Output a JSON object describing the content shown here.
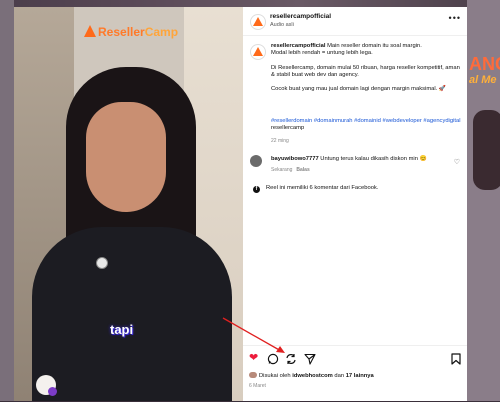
{
  "video": {
    "brand_a": "Reseller",
    "brand_b": "Camp",
    "caption": "tapi"
  },
  "background": {
    "right_text_1": "ANG",
    "right_text_2": "al Me"
  },
  "header": {
    "username": "resellercampofficial",
    "audio": "Audio asli"
  },
  "post": {
    "username": "resellercampofficial",
    "text": " Main reseller domain itu soal margin.\nModal lebih rendah = untung lebih lega.\n\nDi Resellercamp, domain mulai 50 ribuan, harga reseller kompetitif, aman & stabil buat web dev dan agency.\n\nCocok buat yang mau jual domain lagi dengan margin maksimal. 🚀",
    "hashtags": "#resellerdomain #domainmurah #domainid #webdeveloper #agencydigital",
    "mention": " resellercamp",
    "time": "22 ming"
  },
  "comment": {
    "username": "bayuwibowo7777",
    "text": " Untung terus kalau dikasih diskon min 😊",
    "time": "Sekarang",
    "reply": "Balas"
  },
  "facebook_note": "Reel ini memiliki 6 komentar dari Facebook.",
  "actions": {
    "liked_prefix": "Disukai oleh ",
    "liked_by": "idwebhostcom",
    "liked_mid": " dan ",
    "liked_others": "17 lainnya",
    "date": "6 Maret"
  },
  "icons": {
    "like": "heart-icon",
    "comment": "comment-icon",
    "repost": "repost-icon",
    "share": "share-icon",
    "save": "bookmark-icon",
    "more": "more-icon"
  },
  "colors": {
    "like": "#ed1c3c",
    "hashtag": "#1a57d6",
    "arrow": "#e02020"
  }
}
